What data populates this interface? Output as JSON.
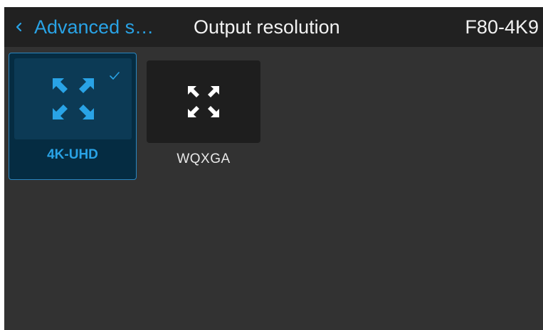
{
  "header": {
    "back_label": "Advanced s…",
    "title": "Output resolution",
    "device": "F80-4K9"
  },
  "options": [
    {
      "label": "4K-UHD",
      "icon": "expand-arrows-icon",
      "selected": true
    },
    {
      "label": "WQXGA",
      "icon": "expand-arrows-icon",
      "selected": false
    }
  ],
  "colors": {
    "accent": "#29a3e6",
    "background": "#323232",
    "header": "#212121",
    "selected_tile": "#052c42",
    "tile": "#1e1e1e"
  }
}
